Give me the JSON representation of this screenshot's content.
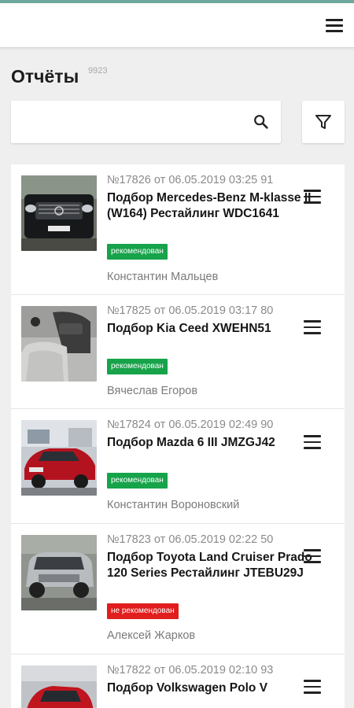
{
  "header": {
    "menu_icon": "hamburger-icon"
  },
  "page": {
    "title": "Отчёты",
    "count": "9923"
  },
  "search": {
    "value": "",
    "placeholder": "",
    "icon": "search-icon"
  },
  "filter": {
    "icon": "filter-icon"
  },
  "reports": [
    {
      "meta": "№17826 от 06.05.2019 03:25 91",
      "title": "Подбор Mercedes-Benz M-klasse II (W164) Рестайлинг WDC1641",
      "status": "рекомендован",
      "status_type": "recommended",
      "inspector": "Константин Мальцев",
      "thumb": "dark-suv-photo"
    },
    {
      "meta": "№17825 от 06.05.2019 03:17 80",
      "title": "Подбор Kia Ceed XWEHN51",
      "status": "рекомендован",
      "status_type": "recommended",
      "inspector": "Вячеслав Егоров",
      "thumb": "car-interior-photo"
    },
    {
      "meta": "№17824 от 06.05.2019 02:49 90",
      "title": "Подбор Mazda 6 III JMZGJ42",
      "status": "рекомендован",
      "status_type": "recommended",
      "inspector": "Константин Вороновский",
      "thumb": "red-sedan-photo"
    },
    {
      "meta": "№17823 от 06.05.2019 02:22 50",
      "title": "Подбор Toyota Land Cruiser Prado 120 Series Рестайлинг JTEBU29J",
      "status": "не рекомендован",
      "status_type": "not-recommended",
      "inspector": "Алексей Жарков",
      "thumb": "silver-suv-photo"
    },
    {
      "meta": "№17822 от 06.05.2019 02:10 93",
      "title": "Подбор Volkswagen Polo V",
      "status": "",
      "status_type": "",
      "inspector": "",
      "thumb": "red-hatchback-photo"
    }
  ],
  "colors": {
    "recommended": "#16a34a",
    "not_recommended": "#e11d1d",
    "accent_top": "#6fa89c"
  }
}
